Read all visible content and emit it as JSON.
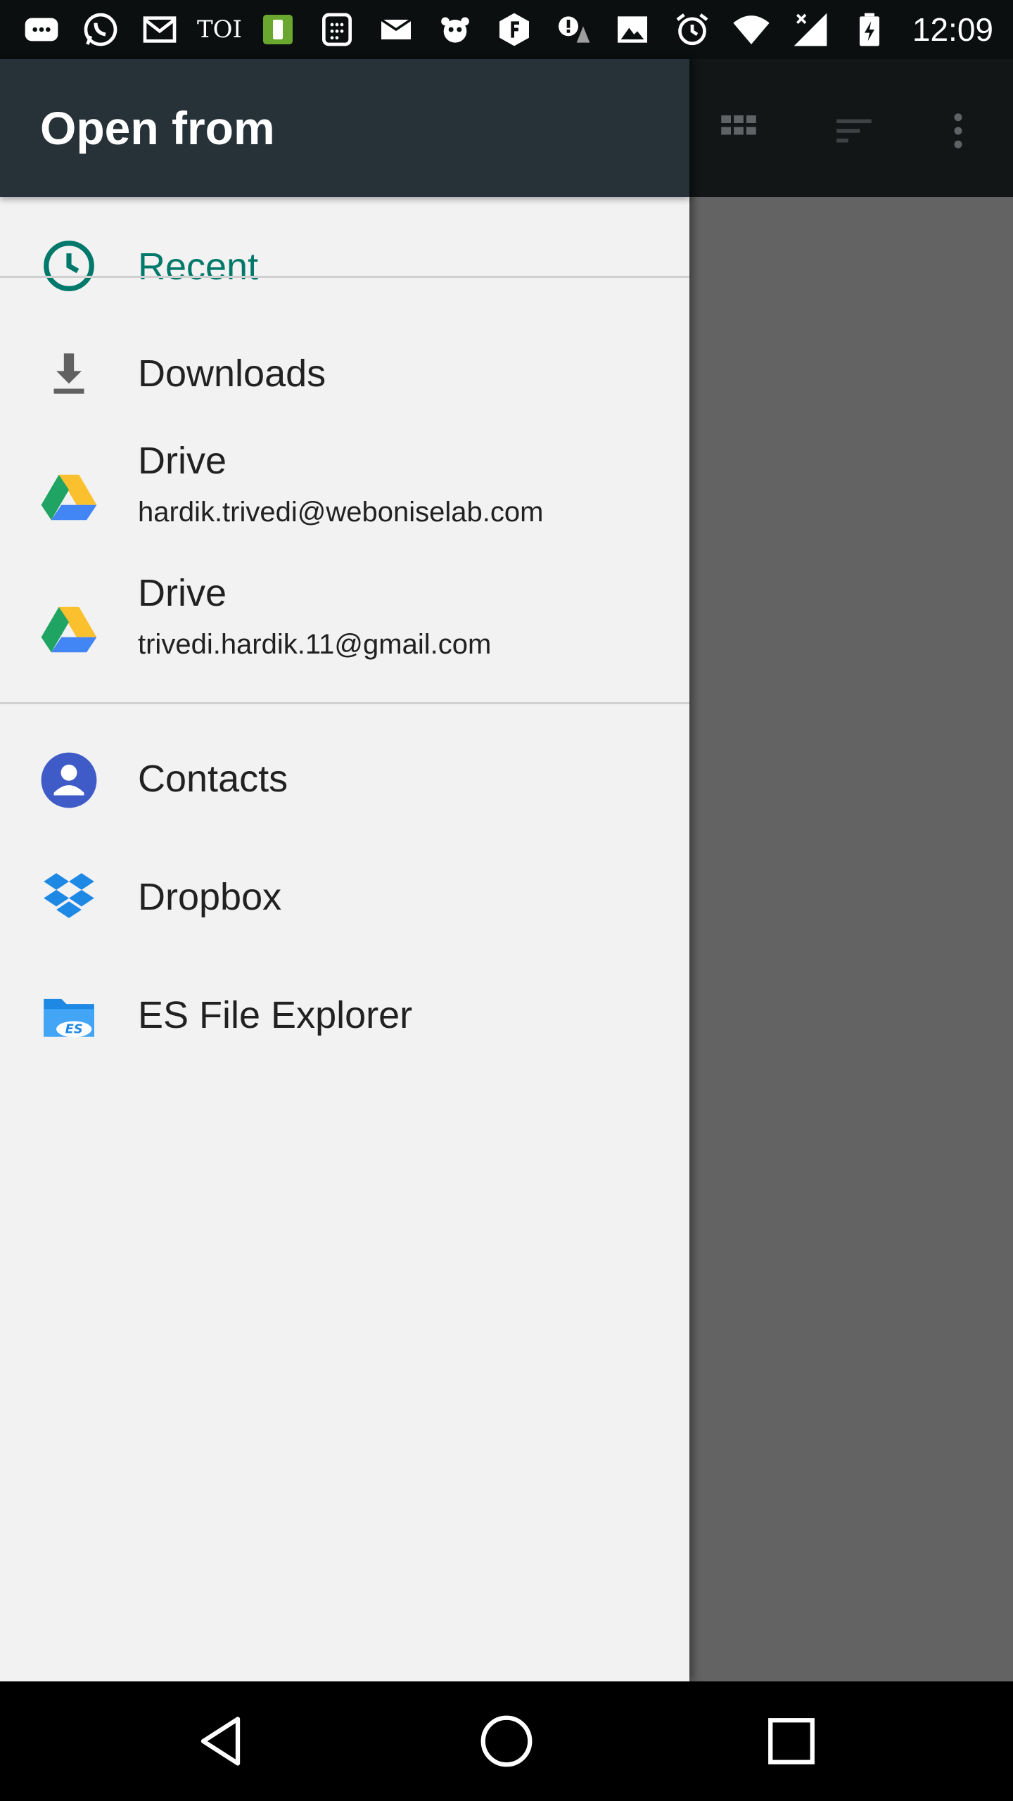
{
  "status_bar": {
    "time": "12:09",
    "notification_icons": [
      "message-icon",
      "whatsapp-icon",
      "gmail-icon",
      "toi-icon",
      "app-icon",
      "calculator-icon",
      "email-icon",
      "foodpanda-icon",
      "flipkart-icon",
      "alert-icon",
      "gallery-icon"
    ],
    "toi_label": "TOI",
    "system_icons": [
      "alarm-icon",
      "wifi-icon",
      "signal-icon",
      "battery-charging-icon"
    ]
  },
  "drawer": {
    "title": "Open from",
    "roots": [
      {
        "label": "Recent",
        "icon": "clock-icon"
      },
      {
        "label": "Downloads",
        "icon": "download-icon"
      },
      {
        "label": "Drive",
        "summary": "hardik.trivedi@weboniselab.com",
        "icon": "drive-icon"
      },
      {
        "label": "Drive",
        "summary": "trivedi.hardik.11@gmail.com",
        "icon": "drive-icon"
      },
      {
        "label": "Contacts",
        "icon": "contacts-icon"
      },
      {
        "label": "Dropbox",
        "icon": "dropbox-icon"
      },
      {
        "label": "ES File Explorer",
        "icon": "es-file-explorer-icon"
      }
    ]
  },
  "background_toolbar": {
    "icons": [
      "grid-view-icon",
      "sort-icon",
      "more-options-icon"
    ]
  },
  "nav_bar": {
    "buttons": [
      "back-icon",
      "home-icon",
      "recents-icon"
    ]
  },
  "colors": {
    "drawer_header": "#263238",
    "drawer_background": "#f2f2f2",
    "accent": "#00796b",
    "status_bar": "#0c0f10"
  }
}
